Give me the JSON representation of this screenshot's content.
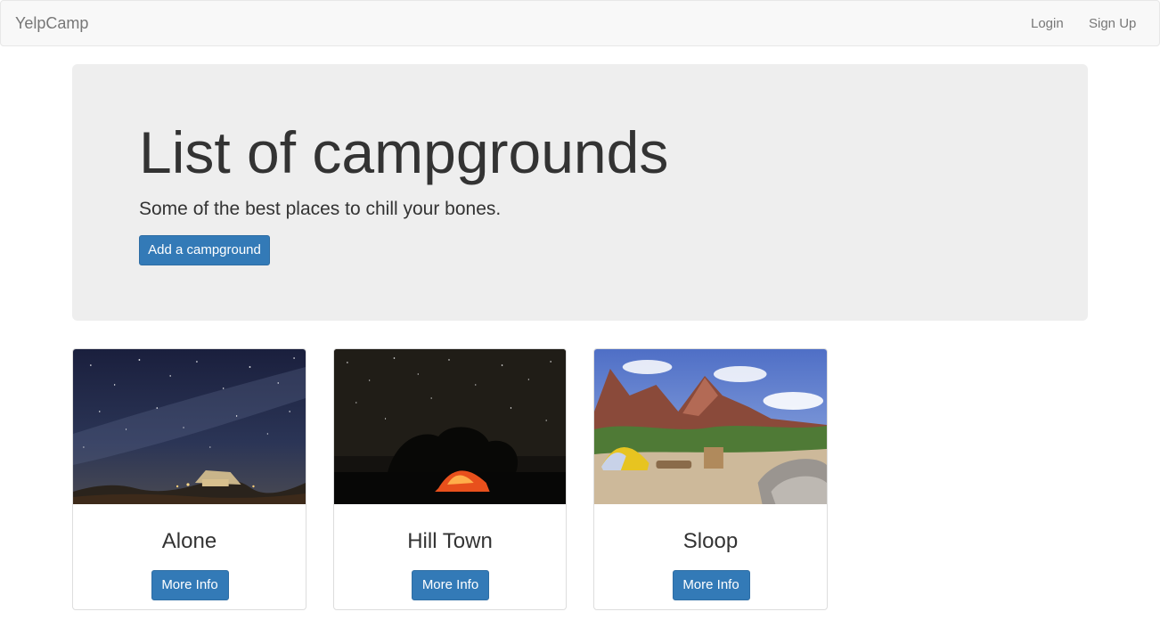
{
  "navbar": {
    "brand": "YelpCamp",
    "login_label": "Login",
    "signup_label": "Sign Up"
  },
  "jumbotron": {
    "title": "List of campgrounds",
    "subtitle": "Some of the best places to chill your bones.",
    "add_button_label": "Add a campground"
  },
  "campgrounds": [
    {
      "name": "Alone",
      "button_label": "More Info"
    },
    {
      "name": "Hill Town",
      "button_label": "More Info"
    },
    {
      "name": "Sloop",
      "button_label": "More Info"
    }
  ],
  "colors": {
    "primary": "#337ab7",
    "navbar_bg": "#f8f8f8",
    "jumbotron_bg": "#eeeeee",
    "nav_text": "#777777"
  }
}
